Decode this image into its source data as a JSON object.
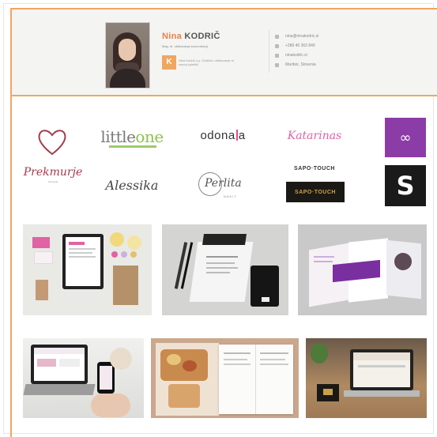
{
  "signature": {
    "first_name": "Nina",
    "last_name": "KODRIČ",
    "title_line": "Mag. dr. oblikovanja komunikacij",
    "company_logo_text": "K",
    "company_text": "Nina Kodrič s.p. Grafično oblikovanje in razvoj spletišč",
    "contacts": [
      "nina@ninakodric.si",
      "+386 40 363 849",
      "ninakodric.si",
      "Maribor, Slovenia"
    ]
  },
  "logos": {
    "prekmurje": "Prekmurje",
    "prekmurje_sub": "Slovenija",
    "littleone_a": "little",
    "littleone_b": "one",
    "alessika": "Alessika",
    "odonata_a": "odona",
    "odonata_b": "a",
    "perlita": "Perlita",
    "perlita_sub": "NAKIT",
    "katarinas": "Katarinas",
    "sapo_top": "SAPO·TOUCH",
    "sapo_dark": "SAPO·TOUCH",
    "purple_symbol": "∞",
    "black_symbol": "S"
  },
  "colors": {
    "accent": "#f0a660",
    "purple": "#8c3ca7",
    "pink": "#e063a5"
  }
}
